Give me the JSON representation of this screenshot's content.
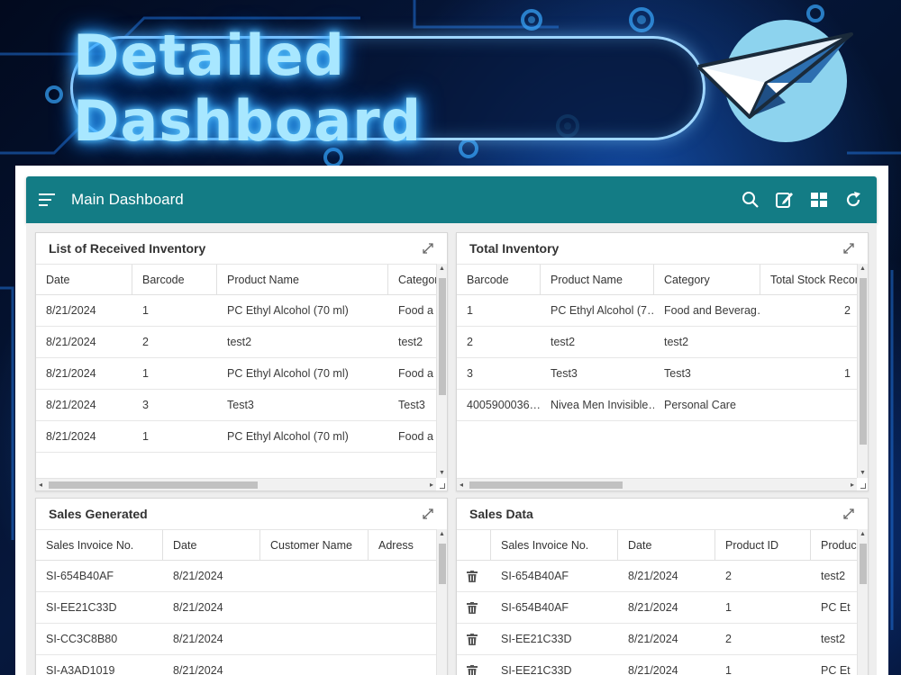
{
  "banner": {
    "title": "Detailed Dashboard"
  },
  "colors": {
    "topbar": "#137c85",
    "banner_glow": "#5fc8ff",
    "logo_circle": "#8dd3ee"
  },
  "app": {
    "title": "Main Dashboard",
    "icons": [
      "menu-icon",
      "search-icon",
      "edit-icon",
      "layout-icon",
      "refresh-icon"
    ]
  },
  "panels": {
    "received": {
      "title": "List of Received Inventory",
      "columns": [
        "Date",
        "Barcode",
        "Product Name",
        "Categor"
      ],
      "rows": [
        [
          "8/21/2024",
          "1",
          "PC Ethyl Alcohol (70 ml)",
          "Food ar"
        ],
        [
          "8/21/2024",
          "2",
          "test2",
          "test2"
        ],
        [
          "8/21/2024",
          "1",
          "PC Ethyl Alcohol (70 ml)",
          "Food ar"
        ],
        [
          "8/21/2024",
          "3",
          "Test3",
          "Test3"
        ],
        [
          "8/21/2024",
          "1",
          "PC Ethyl Alcohol (70 ml)",
          "Food ar"
        ]
      ]
    },
    "total": {
      "title": "Total Inventory",
      "columns": [
        "Barcode",
        "Product Name",
        "Category",
        "Total Stock Record"
      ],
      "rows": [
        [
          "1",
          "PC Ethyl Alcohol (7…",
          "Food and Beverag…",
          "2"
        ],
        [
          "2",
          "test2",
          "test2",
          ""
        ],
        [
          "3",
          "Test3",
          "Test3",
          "1"
        ],
        [
          "4005900036…",
          "Nivea Men Invisible…",
          "Personal Care",
          ""
        ]
      ]
    },
    "sales_generated": {
      "title": "Sales Generated",
      "columns": [
        "Sales Invoice No.",
        "Date",
        "Customer Name",
        "Adress"
      ],
      "rows": [
        [
          "SI-654B40AF",
          "8/21/2024",
          "",
          ""
        ],
        [
          "SI-EE21C33D",
          "8/21/2024",
          "",
          ""
        ],
        [
          "SI-CC3C8B80",
          "8/21/2024",
          "",
          ""
        ],
        [
          "SI-A3AD1019",
          "8/21/2024",
          "",
          ""
        ]
      ]
    },
    "sales_data": {
      "title": "Sales Data",
      "columns": [
        "",
        "Sales Invoice No.",
        "Date",
        "Product ID",
        "Produc"
      ],
      "rows": [
        [
          "",
          "SI-654B40AF",
          "8/21/2024",
          "2",
          "test2"
        ],
        [
          "",
          "SI-654B40AF",
          "8/21/2024",
          "1",
          "PC Ethy"
        ],
        [
          "",
          "SI-EE21C33D",
          "8/21/2024",
          "2",
          "test2"
        ],
        [
          "",
          "SI-EE21C33D",
          "8/21/2024",
          "1",
          "PC Ethy"
        ]
      ]
    }
  }
}
